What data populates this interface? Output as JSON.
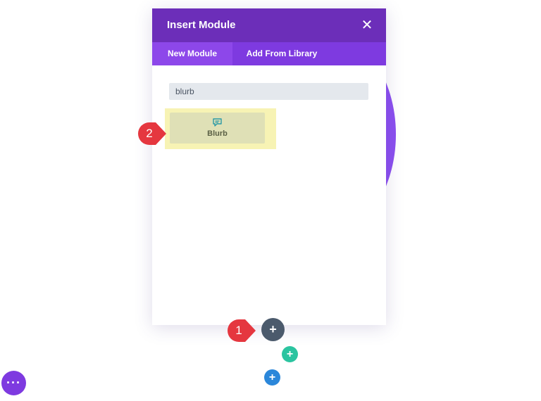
{
  "modal": {
    "title": "Insert Module",
    "close_icon": "close-icon",
    "tabs": [
      {
        "label": "New Module",
        "active": true
      },
      {
        "label": "Add From Library",
        "active": false
      }
    ],
    "search": {
      "value": "blurb"
    },
    "results": [
      {
        "label": "Blurb",
        "icon": "comment-icon"
      }
    ]
  },
  "callouts": [
    {
      "number": "1"
    },
    {
      "number": "2"
    }
  ],
  "buttons": {
    "add_module_symbol": "+",
    "add_row_symbol": "+",
    "add_section_symbol": "+",
    "page_settings_symbol": "···"
  },
  "colors": {
    "header": "#6c2eb9",
    "tab_bar": "#7e3ae0",
    "active_tab": "#8d47ea",
    "highlight": "#f7f3b4",
    "callout": "#e5373f",
    "teal": "#2bc4a0",
    "blue": "#2b87da",
    "dark_slate": "#4b5a6c",
    "purple": "#7e3ae0"
  }
}
